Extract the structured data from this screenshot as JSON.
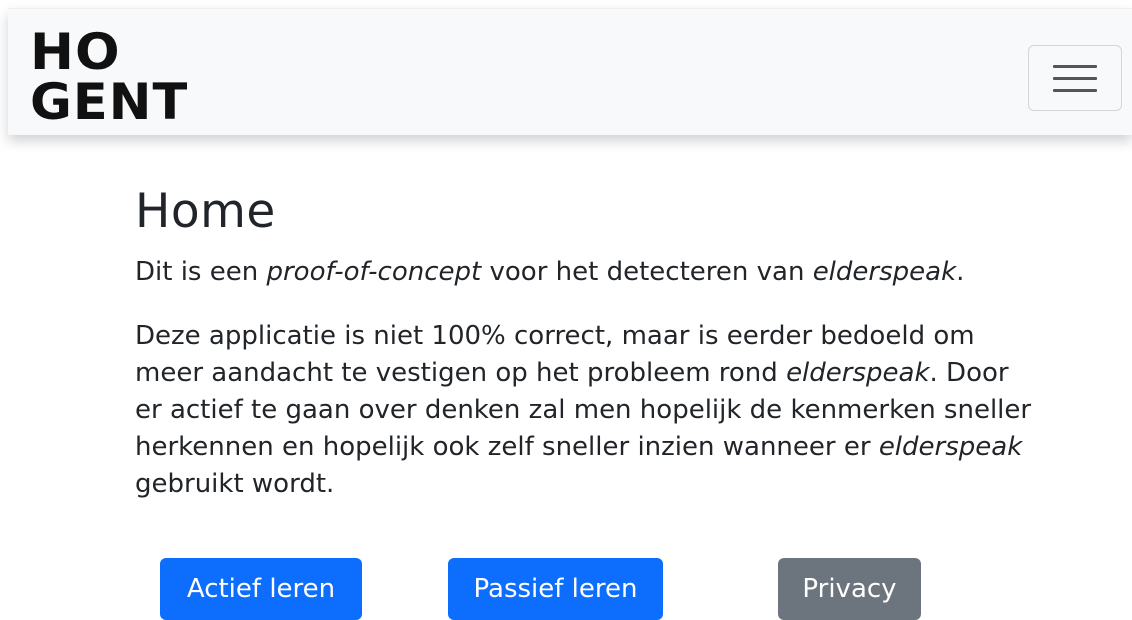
{
  "navbar": {
    "logo_line1": "HO",
    "logo_line2": "GENT",
    "toggler_icon": "hamburger-menu-icon"
  },
  "main": {
    "title": "Home",
    "intro": {
      "part1": "Dit is een ",
      "em1": "proof-of-concept",
      "part2": " voor het detecteren van ",
      "em2": "elderspeak",
      "part3": "."
    },
    "body": {
      "part1": "Deze applicatie is niet 100% correct, maar is eerder bedoeld om meer aandacht te vestigen op het probleem rond ",
      "em1": "elderspeak",
      "part2": ". Door er actief te gaan over denken zal men hopelijk de kenmerken sneller herkennen en hopelijk ook zelf sneller inzien wanneer er ",
      "em2": "elderspeak",
      "part3": " gebruikt wordt."
    },
    "buttons": {
      "actief_label": "Actief leren",
      "passief_label": "Passief leren",
      "privacy_label": "Privacy"
    }
  },
  "colors": {
    "primary": "#0d6efd",
    "secondary": "#6c757d",
    "navbar_bg": "#f8f9fa"
  }
}
